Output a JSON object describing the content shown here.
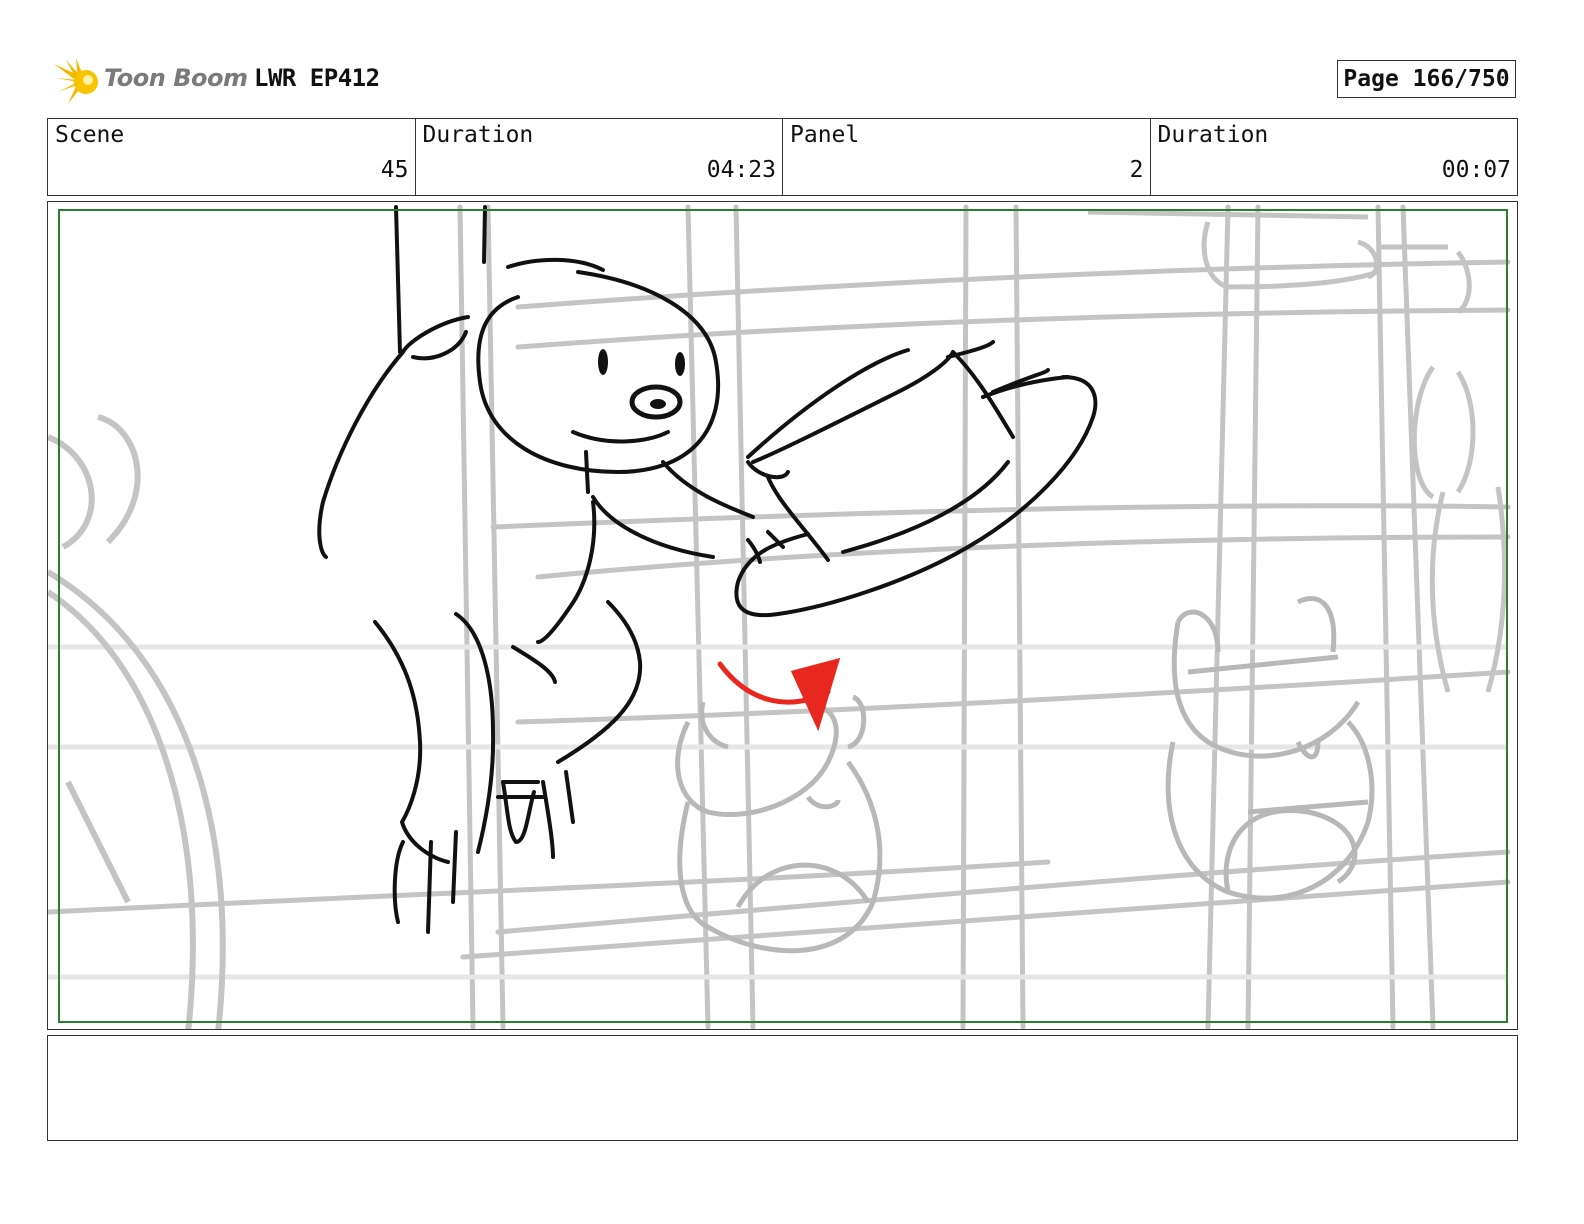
{
  "header": {
    "logo_text": "Toon Boom",
    "project_title": "LWR EP412",
    "page_label": "Page 166/750"
  },
  "info": {
    "scene_label": "Scene",
    "scene_value": "45",
    "scene_duration_label": "Duration",
    "scene_duration_value": "04:23",
    "panel_label": "Panel",
    "panel_value": "2",
    "panel_duration_label": "Duration",
    "panel_duration_value": "00:07"
  },
  "colors": {
    "logo_accent": "#f5b800",
    "frame_green": "#2e7d32",
    "arrow_red": "#e8281e",
    "sketch_grey": "#c4c4c4",
    "ink": "#111111"
  },
  "notes": {
    "text": ""
  }
}
